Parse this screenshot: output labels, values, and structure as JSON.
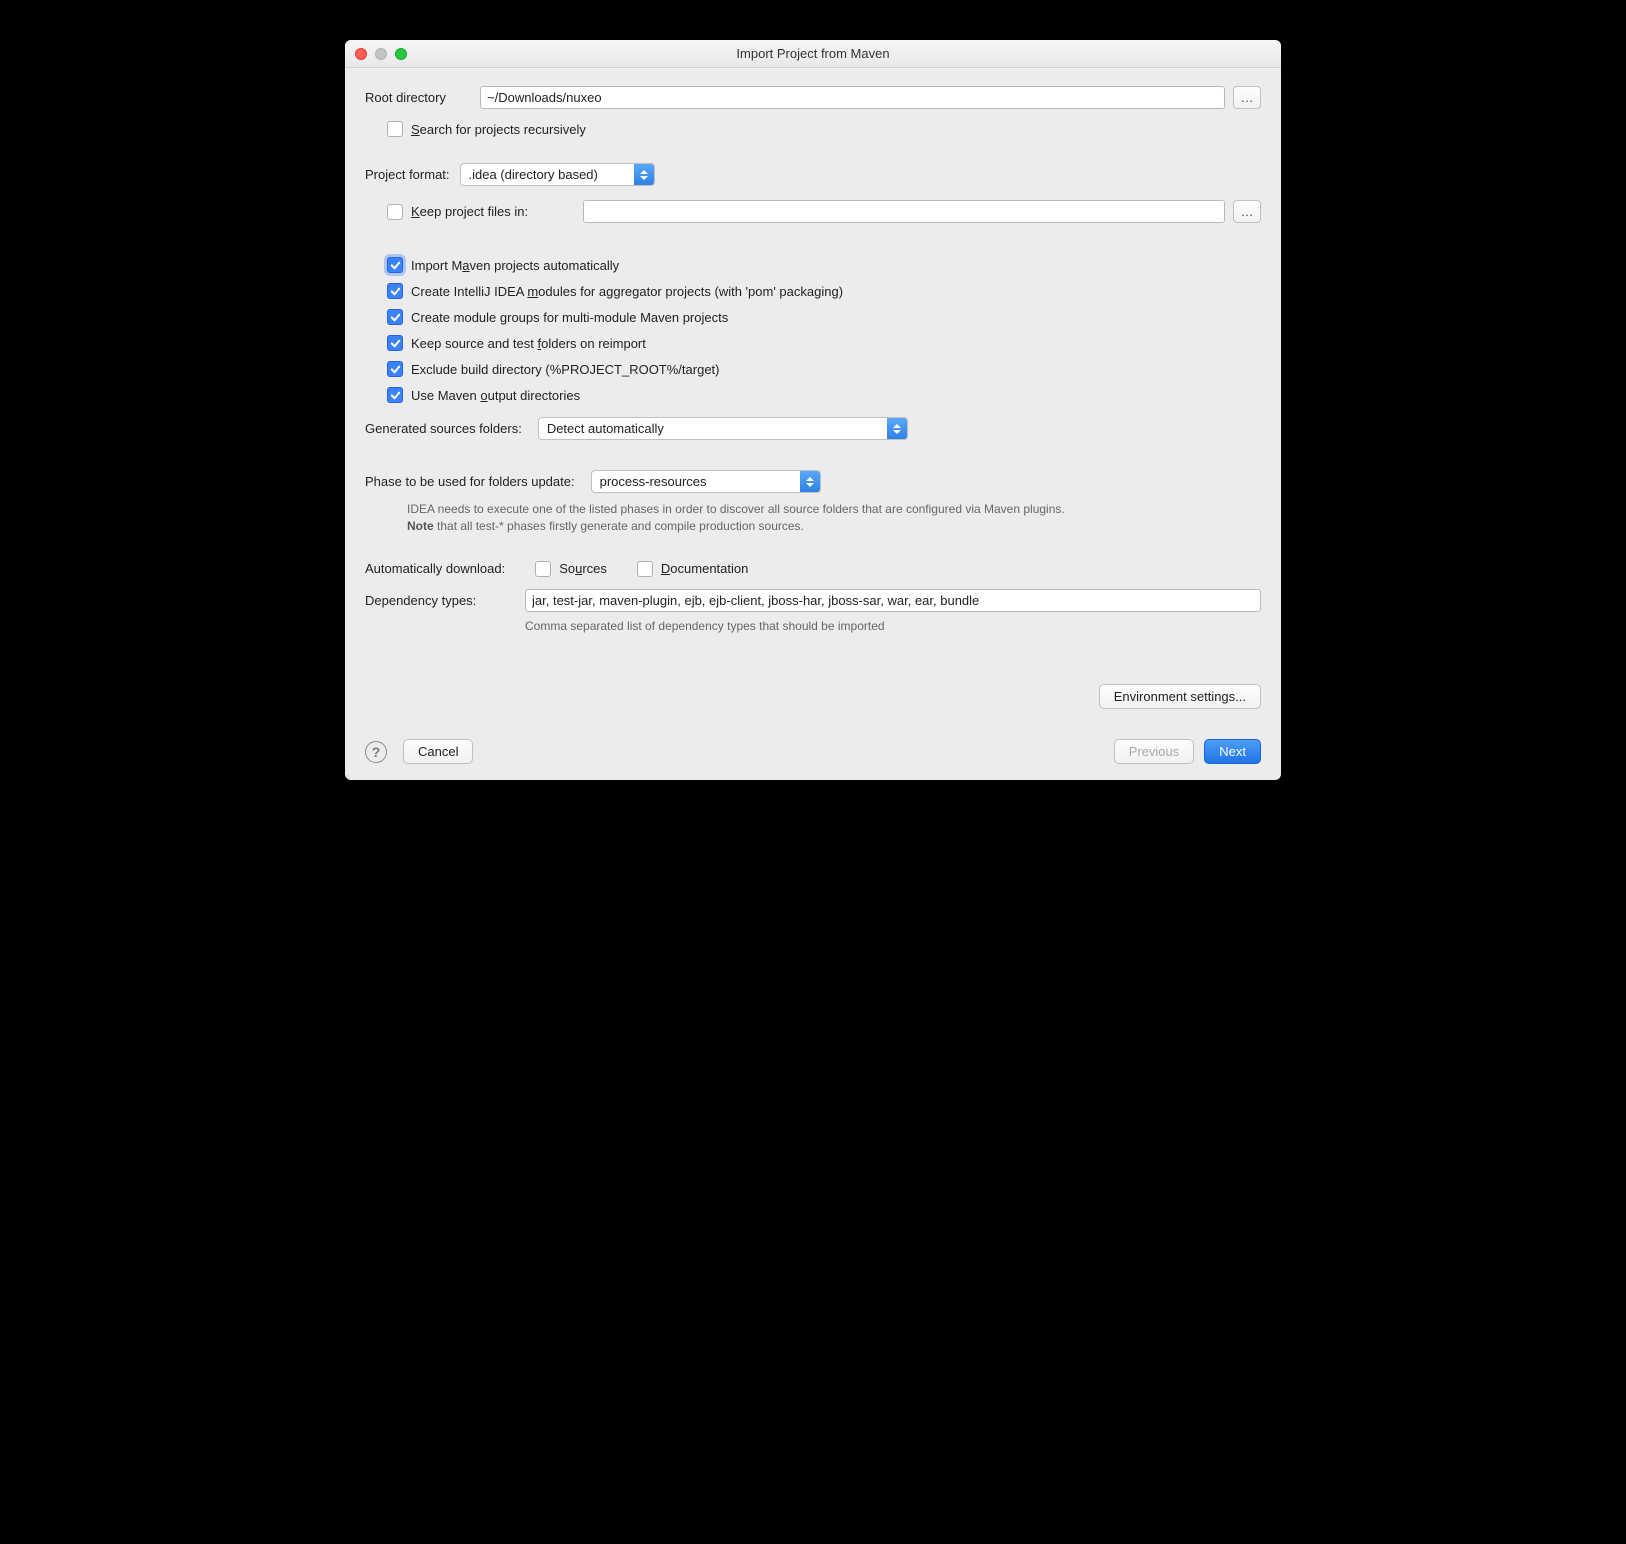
{
  "window": {
    "title": "Import Project from Maven"
  },
  "rootDirectory": {
    "label": "Root directory",
    "value": "~/Downloads/nuxeo"
  },
  "searchRecursively": {
    "label_pre": "",
    "label_u": "S",
    "label_post": "earch for projects recursively",
    "checked": false
  },
  "projectFormat": {
    "label": "Project format:",
    "selected": ".idea (directory based)"
  },
  "keepProjectFiles": {
    "label_pre": "",
    "label_u": "K",
    "label_post": "eep project files in:",
    "checked": false,
    "value": ""
  },
  "opts": {
    "importAuto": {
      "checked": true,
      "pre": "Import M",
      "u": "a",
      "post": "ven projects automatically"
    },
    "createModules": {
      "checked": true,
      "pre": "Create IntelliJ IDEA ",
      "u": "m",
      "post": "odules for aggregator projects (with 'pom' packaging)"
    },
    "moduleGroups": {
      "checked": true,
      "pre": "Create module ",
      "u": "g",
      "post": "roups for multi-module Maven projects"
    },
    "keepFolders": {
      "checked": true,
      "pre": "Keep source and test ",
      "u": "f",
      "post": "olders on reimport"
    },
    "excludeBuild": {
      "checked": true,
      "pre": "Exclude build directory (%PROJECT_ROOT%/target)",
      "u": "",
      "post": ""
    },
    "useOutput": {
      "checked": true,
      "pre": "Use Maven ",
      "u": "o",
      "post": "utput directories"
    }
  },
  "generatedSources": {
    "label": "Generated sources folders:",
    "selected": "Detect automatically"
  },
  "phase": {
    "label": "Phase to be used for folders update:",
    "selected": "process-resources"
  },
  "phaseHint": {
    "line1": "IDEA needs to execute one of the listed phases in order to discover all source folders that are configured via Maven plugins.",
    "line2a": "Note",
    "line2b": " that all test-* phases firstly generate and compile production sources."
  },
  "autoDownload": {
    "label": "Automatically download:",
    "sources": {
      "checked": false,
      "pre": "So",
      "u": "u",
      "post": "rces"
    },
    "docs": {
      "checked": false,
      "pre": "",
      "u": "D",
      "post": "ocumentation"
    }
  },
  "dependencyTypes": {
    "label": "Dependency types:",
    "value": "jar, test-jar, maven-plugin, ejb, ejb-client, jboss-har, jboss-sar, war, ear, bundle",
    "hint": "Comma separated list of dependency types that should be imported"
  },
  "buttons": {
    "envSettings": "Environment settings...",
    "cancel": "Cancel",
    "previous": "Previous",
    "next": "Next"
  }
}
